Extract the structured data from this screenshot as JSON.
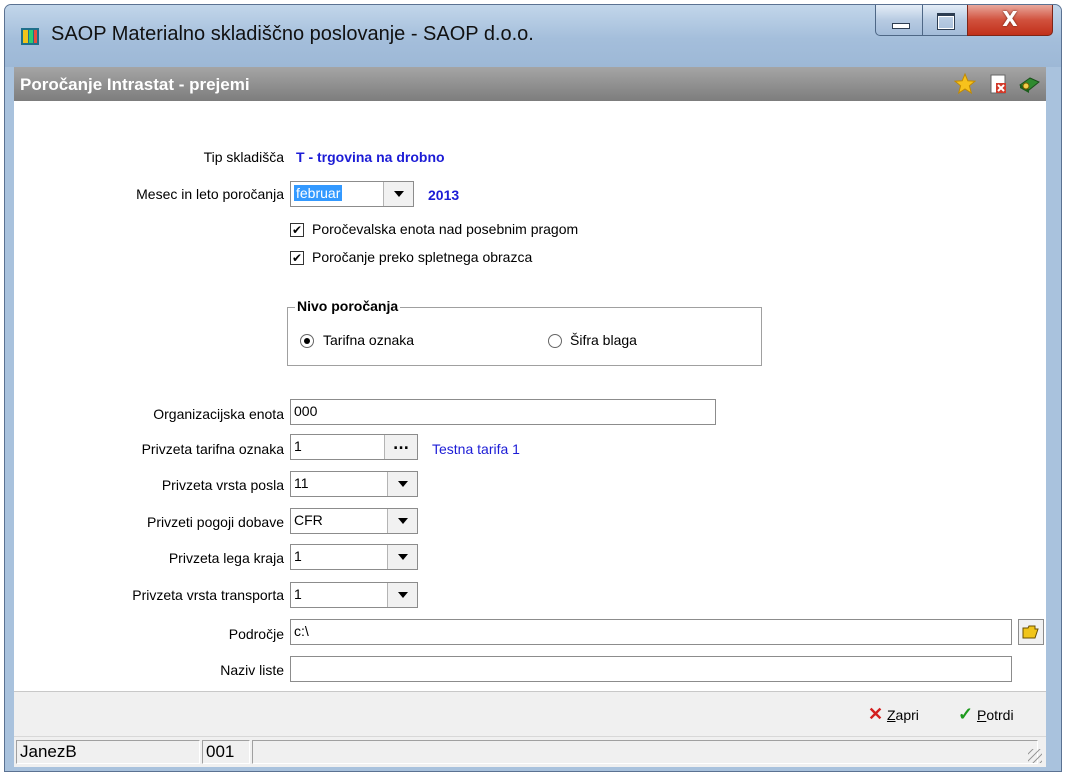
{
  "window": {
    "title": "SAOP Materialno skladiščno poslovanje - SAOP d.o.o."
  },
  "caption_buttons": {
    "close_glyph": "X"
  },
  "form": {
    "title": "Poročanje Intrastat - prejemi",
    "toolbar_icons": [
      "star-icon",
      "close-document-icon",
      "help-book-icon"
    ]
  },
  "fields": {
    "tip_skladisca": {
      "label": "Tip skladišča",
      "value": "T - trgovina na drobno"
    },
    "mesec": {
      "label": "Mesec in leto poročanja",
      "month": "februar",
      "year": "2013"
    },
    "check1": {
      "label": "Poročevalska enota nad posebnim pragom",
      "checked": true
    },
    "check2": {
      "label": "Poročanje preko spletnega obrazca",
      "checked": true
    },
    "nivo": {
      "title": "Nivo poročanja",
      "options": [
        {
          "label": "Tarifna oznaka",
          "selected": true
        },
        {
          "label": "Šifra blaga",
          "selected": false
        }
      ]
    },
    "org_enota": {
      "label": "Organizacijska enota",
      "value": "000"
    },
    "tarifna": {
      "label": "Privzeta tarifna oznaka",
      "value": "1",
      "button": "...",
      "description": "Testna tarifa 1"
    },
    "vrsta_posla": {
      "label": "Privzeta vrsta posla",
      "value": "11"
    },
    "pogoji": {
      "label": "Privzeti pogoji dobave",
      "value": "CFR"
    },
    "lega": {
      "label": "Privzeta lega kraja",
      "value": "1"
    },
    "transport": {
      "label": "Privzeta vrsta transporta",
      "value": "1"
    },
    "podrocje": {
      "label": "Področje",
      "value": "c:\\"
    },
    "naziv": {
      "label": "Naziv liste",
      "value": ""
    }
  },
  "buttons": {
    "zapri": {
      "label": "Zapri",
      "hotkey": "Z",
      "rest": "apri"
    },
    "potrdi": {
      "label": "Potrdi",
      "hotkey": "P",
      "rest": "otrdi"
    }
  },
  "status": {
    "user": "JanezB",
    "code": "001"
  },
  "colors": {
    "accent_blue": "#1c1cd6",
    "form_header": "#8e8e8e",
    "close_red": "#c1301a"
  }
}
